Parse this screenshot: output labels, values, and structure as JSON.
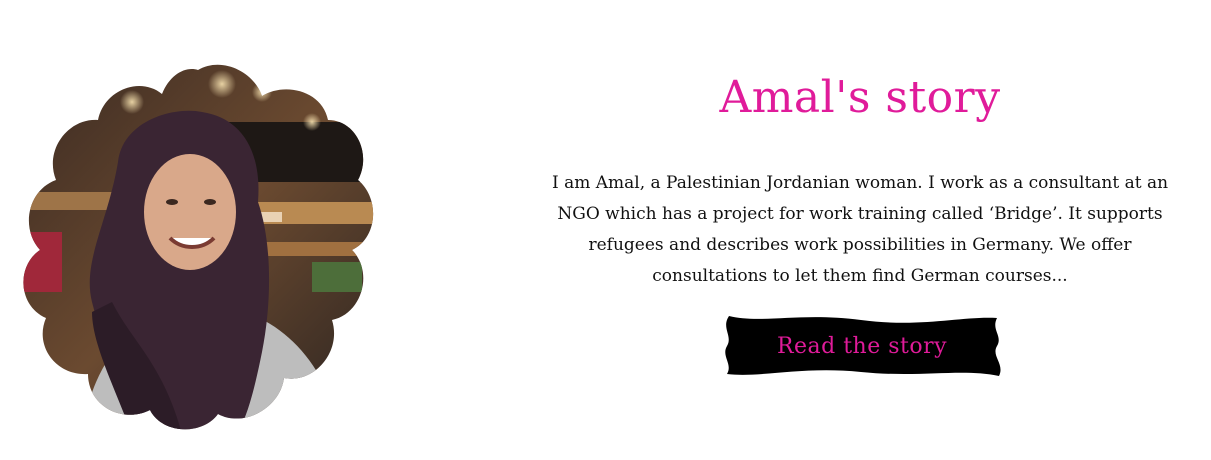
{
  "story": {
    "title": "Amal's story",
    "excerpt": "I am Amal, a Palestinian Jordanian woman. I work as a consultant at an NGO which has a project for work training called ‘Bridge’. It supports refugees and describes work possibilities in Germany. We offer consultations to let them find German courses...",
    "cta_label": "Read the story"
  },
  "colors": {
    "accent": "#e01b9a",
    "button_bg": "#000000",
    "text": "#111111",
    "background": "#ffffff"
  },
  "image": {
    "subject": "portrait-photo",
    "frame_shape": "flower-scalloped"
  }
}
